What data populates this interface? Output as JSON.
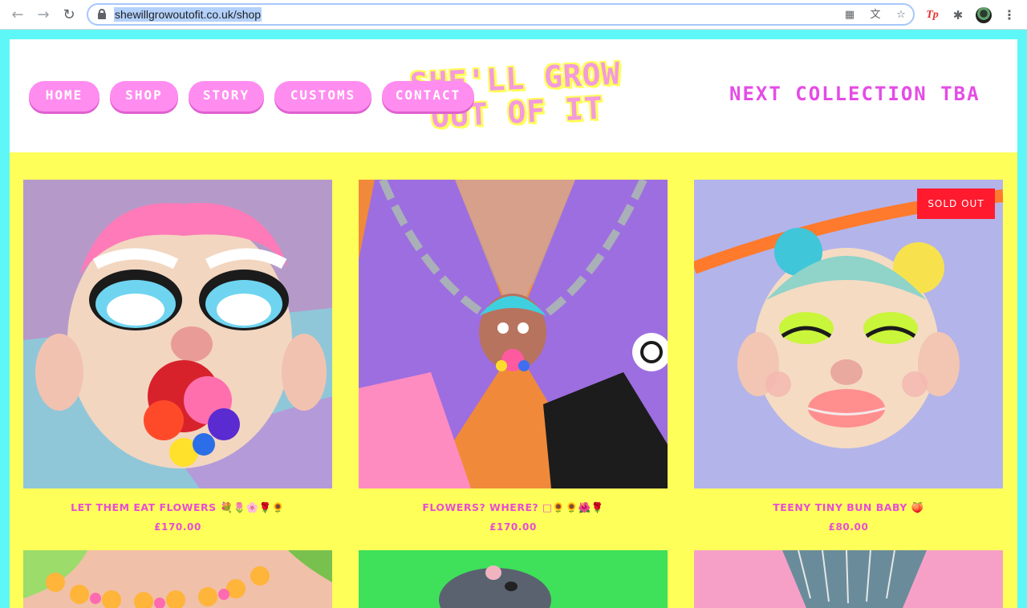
{
  "browser": {
    "url": "shewillgrowoutofit.co.uk/shop"
  },
  "site": {
    "logo_line1": "SHE'LL GROW",
    "logo_line2": "OUT OF IT",
    "nav": [
      {
        "label": "HOME"
      },
      {
        "label": "SHOP"
      },
      {
        "label": "STORY"
      },
      {
        "label": "CUSTOMS"
      },
      {
        "label": "CONTACT"
      }
    ],
    "tagline": "NEXT COLLECTION TBA"
  },
  "products": [
    {
      "title": "LET THEM EAT FLOWERS 💐🌷🌸🌹🌻",
      "price": "£170.00",
      "badge": ""
    },
    {
      "title": "FLOWERS? WHERE? □🌻🌻🌺🌹",
      "price": "£170.00",
      "badge": ""
    },
    {
      "title": "TEENY TINY BUN BABY 🍑",
      "price": "£80.00",
      "badge": "SOLD OUT"
    }
  ],
  "colors": {
    "page_bg": "#ffff5a",
    "frame": "#5ef7f7",
    "nav_pill": "#ff8df0",
    "text_pink": "#e84dd5",
    "sold_badge": "#ff1a2e"
  }
}
